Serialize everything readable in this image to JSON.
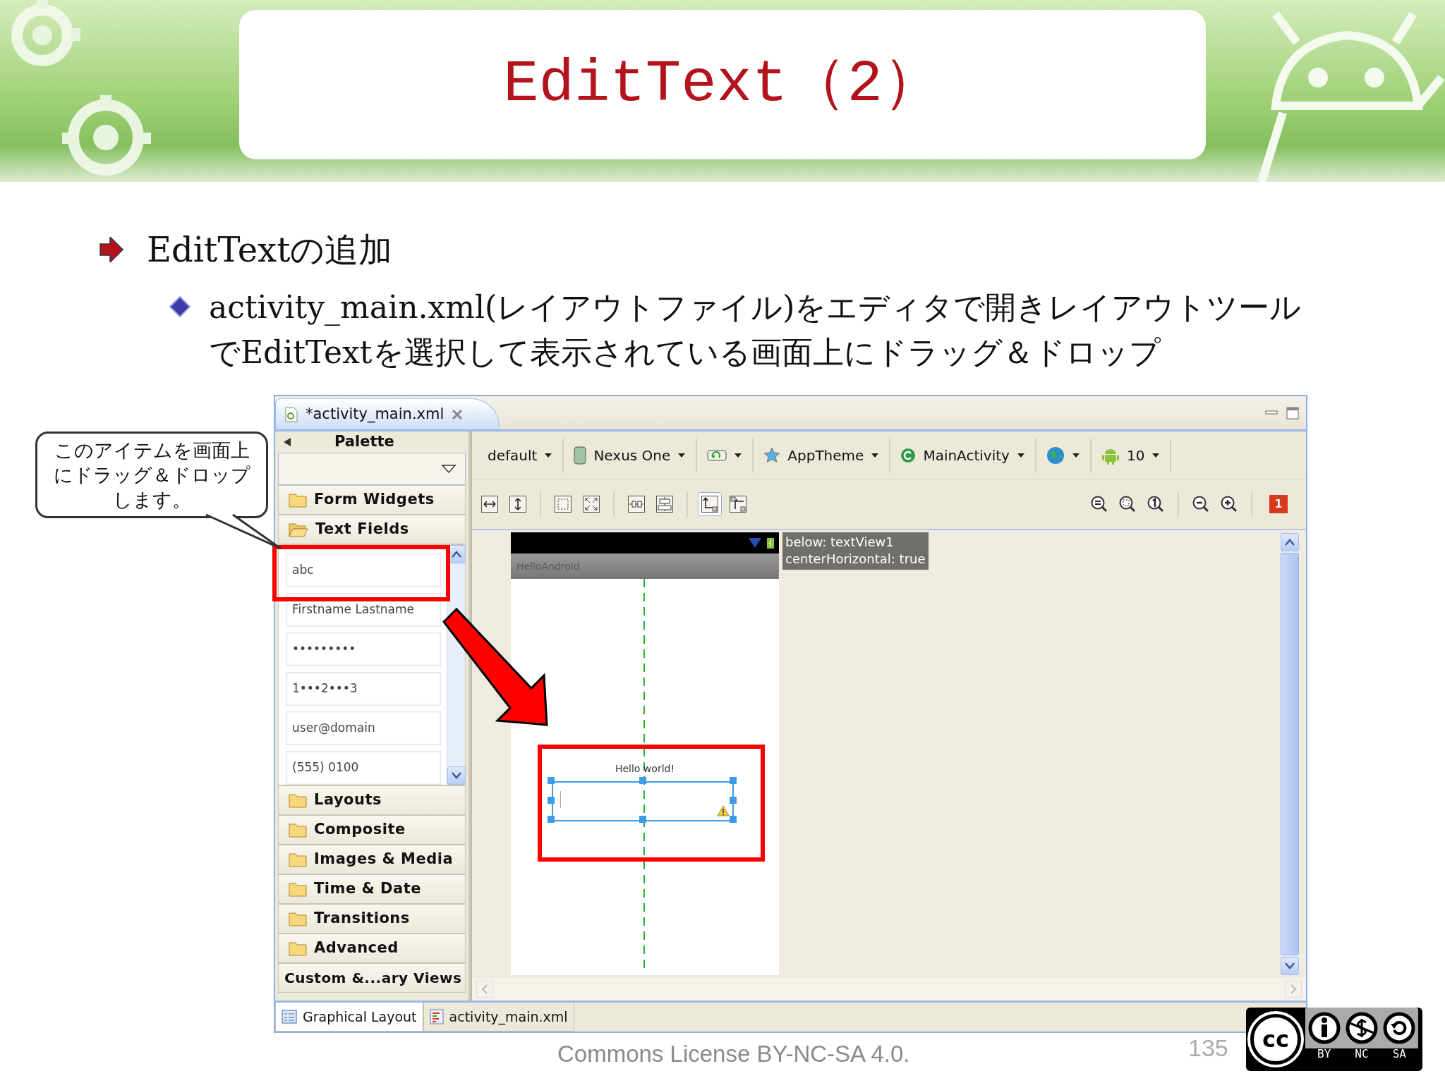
{
  "slide": {
    "title": "EditText（2）",
    "bullets": [
      {
        "kind": "heading",
        "text": "EditTextの追加"
      },
      {
        "kind": "sub",
        "text": "activity_main.xml(レイアウトファイル)をエディタで開きレイアウトツールでEditTextを選択して表示されている画面上にドラッグ＆ドロップ"
      }
    ]
  },
  "callout": "このアイテムを画面上にドラッグ＆ドロップします。",
  "editor": {
    "file_tab": {
      "label": "*activity_main.xml",
      "selected": true
    },
    "palette": {
      "title": "Palette",
      "categories": [
        {
          "label": "Form Widgets",
          "kind": "folder",
          "expanded": false
        },
        {
          "label": "Text Fields",
          "kind": "folder",
          "expanded": true,
          "items": [
            "abc",
            "Firstname Lastname",
            "•••••••••",
            "1•••2•••3",
            "user@domain",
            "(555) 0100"
          ]
        },
        {
          "label": "Layouts",
          "kind": "folder",
          "expanded": false
        },
        {
          "label": "Composite",
          "kind": "folder",
          "expanded": false
        },
        {
          "label": "Images & Media",
          "kind": "folder",
          "expanded": false
        },
        {
          "label": "Time & Date",
          "kind": "folder",
          "expanded": false
        },
        {
          "label": "Transitions",
          "kind": "folder",
          "expanded": false
        },
        {
          "label": "Advanced",
          "kind": "folder",
          "expanded": false
        },
        {
          "label": "Custom &...ary Views",
          "kind": "plain"
        }
      ]
    },
    "config_bar": [
      {
        "kind": "text",
        "label": "default"
      },
      {
        "kind": "device",
        "label": "Nexus One"
      },
      {
        "kind": "orientation"
      },
      {
        "kind": "theme",
        "label": "AppTheme"
      },
      {
        "kind": "activity",
        "label": "MainActivity"
      },
      {
        "kind": "locale"
      },
      {
        "kind": "api",
        "label": "10"
      }
    ],
    "layout_tools": [
      {
        "kind": "fill-width",
        "selected": false
      },
      {
        "kind": "fill-height",
        "selected": false
      },
      {
        "kind": "margins",
        "selected": false
      },
      {
        "kind": "resize",
        "selected": false
      },
      {
        "kind": "distribute",
        "selected": false
      },
      {
        "kind": "center",
        "selected": false
      },
      {
        "kind": "corner",
        "selected": true
      },
      {
        "kind": "corner-alt",
        "selected": false
      }
    ],
    "zoom_tools": [
      {
        "kind": "fit"
      },
      {
        "kind": "real"
      },
      {
        "kind": "actual"
      },
      {
        "kind": "out"
      },
      {
        "kind": "in"
      }
    ],
    "error_count": "1",
    "canvas": {
      "app_title": "HelloAndroid",
      "text_view": "Hello world!",
      "tooltip": [
        "below: textView1",
        "centerHorizontal: true"
      ]
    },
    "view_tabs": [
      {
        "label": "Graphical Layout",
        "selected": true
      },
      {
        "label": "activity_main.xml",
        "selected": false
      }
    ]
  },
  "footer": {
    "license": "Commons License BY-NC-SA 4.0.",
    "page": "135",
    "badge": {
      "mark": "cc",
      "labels": [
        "BY",
        "NC",
        "SA"
      ]
    }
  }
}
